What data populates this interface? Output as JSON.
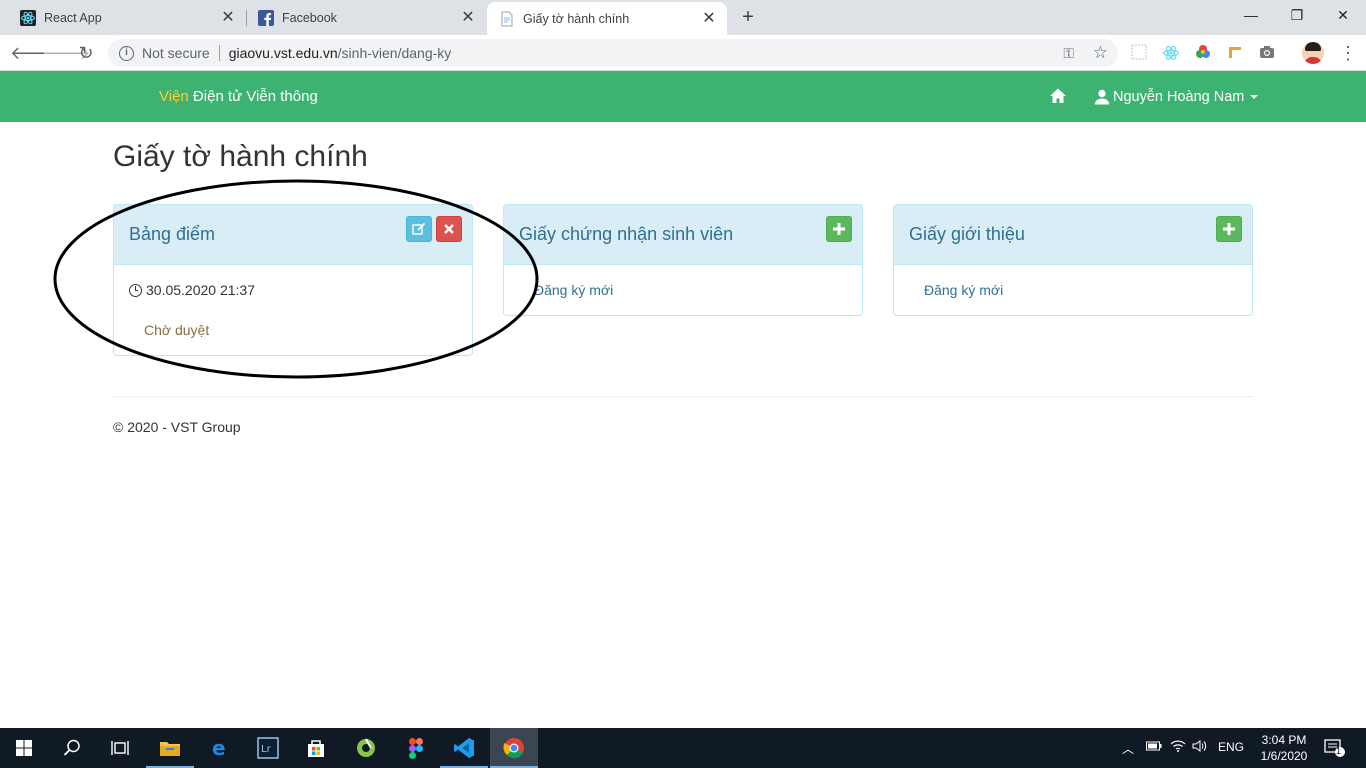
{
  "browser": {
    "tabs": [
      {
        "title": "React App",
        "icon": "react-icon"
      },
      {
        "title": "Facebook",
        "icon": "facebook-icon"
      },
      {
        "title": "Giấy tờ hành chính",
        "icon": "document-icon",
        "active": true
      }
    ],
    "address": {
      "security": "Not secure",
      "host": "giaovu.vst.edu.vn",
      "path": "/sinh-vien/dang-ky"
    }
  },
  "navbar": {
    "brand_highlight": "Viện",
    "brand_rest": " Điện tử Viễn thông",
    "user_name": "Nguyễn Hoàng Nam",
    "colors": {
      "background": "#3cb371",
      "brand_highlight": "#ffcc33"
    }
  },
  "page": {
    "title": "Giấy tờ hành chính",
    "panels": [
      {
        "title": "Bảng điểm",
        "datetime": "30.05.2020 21:37",
        "status": "Chờ duyệt",
        "actions": [
          "edit-icon",
          "remove-icon"
        ]
      },
      {
        "title": "Giấy chứng nhận sinh viên",
        "link": "Đăng ký mới",
        "actions": [
          "plus-icon"
        ]
      },
      {
        "title": "Giấy giới thiệu",
        "link": "Đăng ký mới",
        "actions": [
          "plus-icon"
        ]
      }
    ],
    "footer": "© 2020 - VST Group"
  },
  "taskbar": {
    "language": "ENG",
    "time": "3:04 PM",
    "date": "1/6/2020",
    "notifications": "1"
  }
}
